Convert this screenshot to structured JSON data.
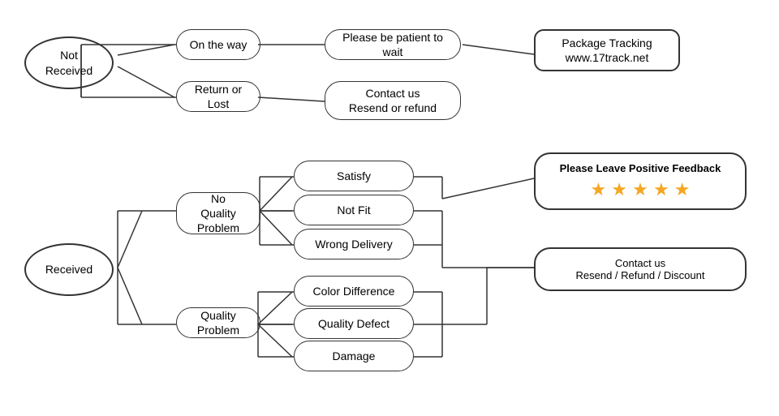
{
  "nodes": {
    "not_received": {
      "label": "Not\nReceived"
    },
    "on_the_way": {
      "label": "On the way"
    },
    "return_or_lost": {
      "label": "Return or Lost"
    },
    "please_be_patient": {
      "label": "Please be patient to wait"
    },
    "package_tracking": {
      "label": "Package Tracking\nwww.17track.net"
    },
    "contact_resend_refund": {
      "label": "Contact us\nResend or refund"
    },
    "received": {
      "label": "Received"
    },
    "no_quality_problem": {
      "label": "No\nQuality Problem"
    },
    "quality_problem": {
      "label": "Quality Problem"
    },
    "satisfy": {
      "label": "Satisfy"
    },
    "not_fit": {
      "label": "Not Fit"
    },
    "wrong_delivery": {
      "label": "Wrong Delivery"
    },
    "color_difference": {
      "label": "Color Difference"
    },
    "quality_defect": {
      "label": "Quality Defect"
    },
    "damage": {
      "label": "Damage"
    },
    "feedback": {
      "label": "Please Leave Positive Feedback"
    },
    "stars": {
      "label": "★ ★ ★ ★ ★"
    },
    "contact_resend_refund_discount": {
      "label": "Contact us\nResend / Refund / Discount"
    }
  }
}
